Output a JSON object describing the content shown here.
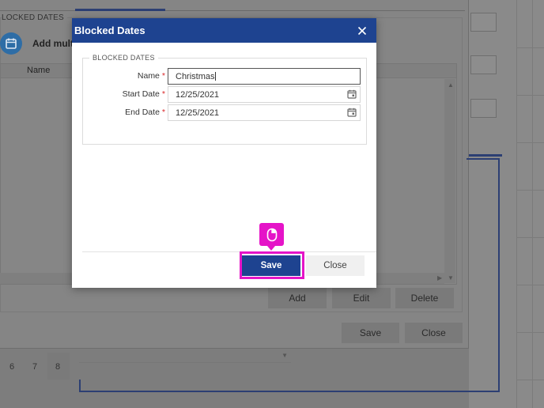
{
  "background": {
    "fieldset_legend": "LOCKED DATES",
    "add_multi_label": "Add multi",
    "grid_column_name": "Name",
    "buttons": {
      "add": "Add",
      "edit": "Edit",
      "delete": "Delete",
      "save": "Save",
      "close": "Close"
    },
    "calendar_days": [
      "6",
      "7",
      "8"
    ]
  },
  "dialog": {
    "title": "Blocked Dates",
    "fieldset_legend": "BLOCKED DATES",
    "fields": {
      "name": {
        "label": "Name",
        "required_mark": "*",
        "value": "Christmas"
      },
      "start_date": {
        "label": "Start Date",
        "required_mark": "*",
        "value": "12/25/2021"
      },
      "end_date": {
        "label": "End Date",
        "required_mark": "*",
        "value": "12/25/2021"
      }
    },
    "buttons": {
      "save": "Save",
      "close": "Close"
    }
  },
  "colors": {
    "dialog_header": "#1e4390",
    "primary_button": "#1e4390",
    "highlight": "#e514c8",
    "required": "#d9262a"
  },
  "icons": {
    "dialog_close": "close-icon",
    "date_picker": "calendar-icon",
    "click_indicator": "mouse-icon"
  }
}
